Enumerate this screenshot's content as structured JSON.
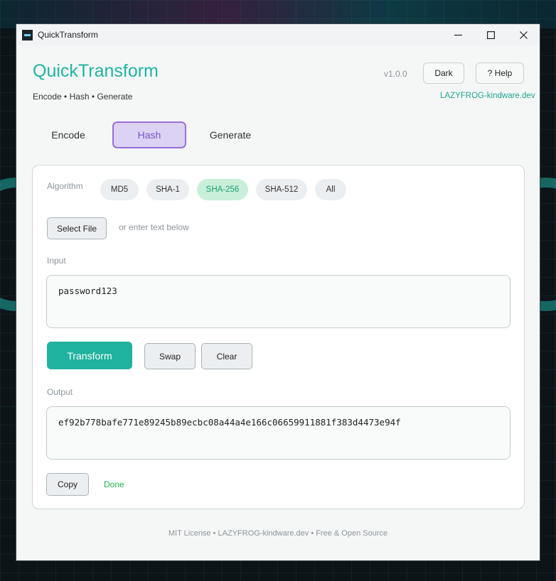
{
  "window": {
    "title": "QuickTransform",
    "controls": {
      "minimize": "—",
      "maximize": "☐",
      "close": "✕"
    }
  },
  "header": {
    "app_name": "QuickTransform",
    "tagline": "Encode • Hash • Generate",
    "version": "v1.0.0",
    "dark_label": "Dark",
    "help_label": "? Help",
    "site": "LAZYFROG-kindware.dev"
  },
  "tabs": [
    {
      "label": "Encode",
      "active": false
    },
    {
      "label": "Hash",
      "active": true
    },
    {
      "label": "Generate",
      "active": false
    }
  ],
  "hash_panel": {
    "algorithm_label": "Algorithm",
    "algorithms": [
      {
        "label": "MD5",
        "selected": false
      },
      {
        "label": "SHA-1",
        "selected": false
      },
      {
        "label": "SHA-256",
        "selected": true
      },
      {
        "label": "SHA-512",
        "selected": false
      },
      {
        "label": "All",
        "selected": false
      }
    ],
    "select_file_label": "Select File",
    "file_hint": "or enter text below",
    "input_label": "Input",
    "input_value": "password123",
    "transform_label": "Transform",
    "swap_label": "Swap",
    "clear_label": "Clear",
    "output_label": "Output",
    "output_value": "ef92b778bafe771e89245b89ecbc08a44a4e166c06659911881f383d4473e94f",
    "copy_label": "Copy",
    "status": "Done"
  },
  "footer": {
    "text": "MIT License • LAZYFROG-kindware.dev • Free & Open Source"
  },
  "colors": {
    "accent": "#1fb29e",
    "tab_active_border": "#9a6dde",
    "tab_active_bg": "#dcd2f4",
    "chip_selected_bg": "#c9efd9",
    "status_success": "#22b04e"
  }
}
